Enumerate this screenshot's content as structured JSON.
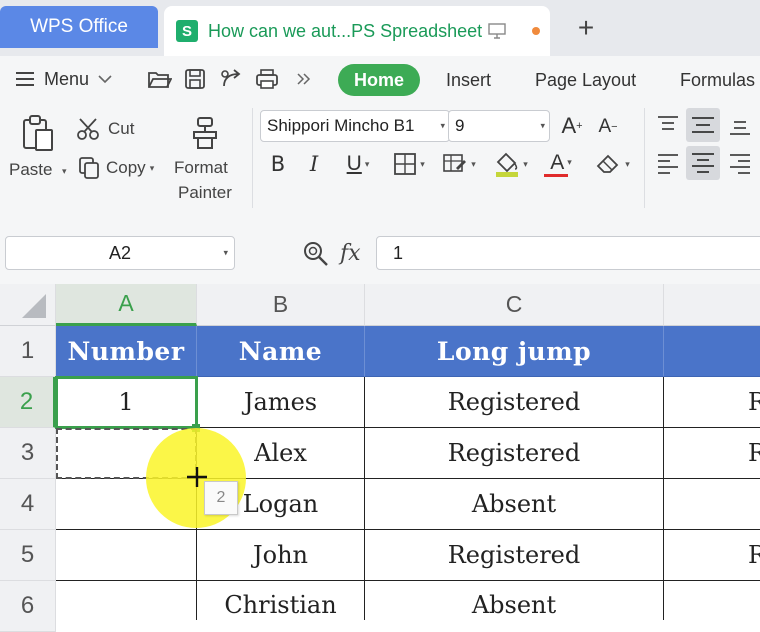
{
  "titlebar": {
    "app_tab": "WPS Office",
    "doc_tab": "How can we aut...PS Spreadsheet",
    "new_tab": "+"
  },
  "menu": {
    "menu_label": "Menu",
    "tabs": [
      "Home",
      "Insert",
      "Page Layout",
      "Formulas"
    ]
  },
  "ribbon": {
    "paste": "Paste",
    "cut": "Cut",
    "copy": "Copy",
    "format_painter_line1": "Format",
    "format_painter_line2": "Painter",
    "font_name": "Shippori Mincho B1",
    "font_size": "9",
    "bold": "B",
    "italic": "I",
    "underline": "U",
    "font_color_glyph": "A",
    "grow_font": "A",
    "shrink_font": "A"
  },
  "formula_bar": {
    "name_box": "A2",
    "fx": "fx",
    "value": "1"
  },
  "grid": {
    "columns": [
      "A",
      "B",
      "C"
    ],
    "rows": [
      "1",
      "2",
      "3",
      "4",
      "5",
      "6"
    ],
    "header": [
      "Number",
      "Name",
      "Long jump"
    ],
    "data": [
      [
        "1",
        "James",
        "Registered",
        "R"
      ],
      [
        "",
        "Alex",
        "Registered",
        "R"
      ],
      [
        "",
        "Logan",
        "Absent",
        ""
      ],
      [
        "",
        "John",
        "Registered",
        "R"
      ],
      [
        "",
        "Christian",
        "Absent",
        ""
      ]
    ],
    "autofill_tip": "2"
  },
  "colors": {
    "accent_green": "#3aa04c",
    "header_blue": "#4a74c9",
    "wps_blue": "#5b88e6"
  }
}
